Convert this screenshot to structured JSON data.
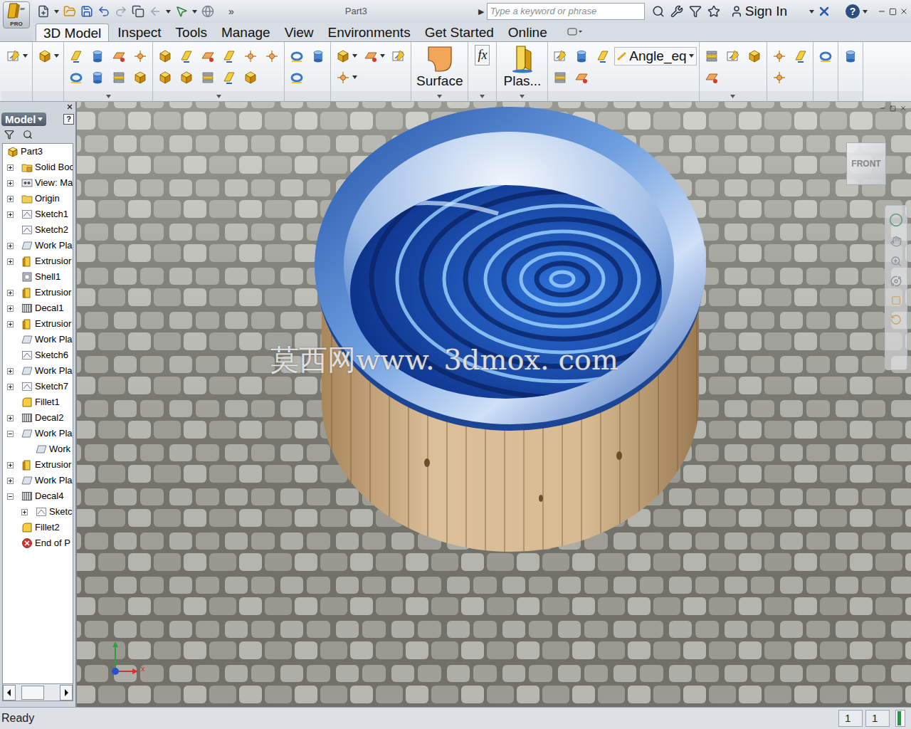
{
  "app": {
    "badge": "PRO"
  },
  "quick_access": {
    "overflow": "»"
  },
  "window": {
    "title": "Part3",
    "title_arrow": "▶"
  },
  "search": {
    "placeholder": "Type a keyword or phrase"
  },
  "account": {
    "sign_in": "Sign In"
  },
  "help": {
    "label": "?"
  },
  "menu_tabs": [
    {
      "label": "3D Model",
      "selected": true
    },
    {
      "label": "Inspect",
      "selected": false
    },
    {
      "label": "Tools",
      "selected": false
    },
    {
      "label": "Manage",
      "selected": false
    },
    {
      "label": "View",
      "selected": false
    },
    {
      "label": "Environments",
      "selected": false
    },
    {
      "label": "Get Started",
      "selected": false
    },
    {
      "label": "Online",
      "selected": false
    }
  ],
  "ribbon": {
    "surface": "Surface",
    "plastic_part": "Plas...",
    "function": "fx",
    "parameter": "Angle_eq"
  },
  "browser": {
    "title": "Model",
    "help": "?",
    "items": [
      {
        "label": "Part3",
        "depth": 0,
        "kind": "part",
        "expandable": false,
        "expanded": false
      },
      {
        "label": "Solid Boc",
        "depth": 1,
        "kind": "solid",
        "expandable": true,
        "expanded": false
      },
      {
        "label": "View: Ma",
        "depth": 1,
        "kind": "view",
        "expandable": true,
        "expanded": false
      },
      {
        "label": "Origin",
        "depth": 1,
        "kind": "folder",
        "expandable": true,
        "expanded": false
      },
      {
        "label": "Sketch1",
        "depth": 1,
        "kind": "sketch",
        "expandable": true,
        "expanded": false
      },
      {
        "label": "Sketch2",
        "depth": 1,
        "kind": "sketch",
        "expandable": false,
        "expanded": false
      },
      {
        "label": "Work Pla",
        "depth": 1,
        "kind": "work-plane",
        "expandable": true,
        "expanded": false
      },
      {
        "label": "Extrusior",
        "depth": 1,
        "kind": "extrusion",
        "expandable": true,
        "expanded": false
      },
      {
        "label": "Shell1",
        "depth": 1,
        "kind": "shell",
        "expandable": false,
        "expanded": false
      },
      {
        "label": "Extrusior",
        "depth": 1,
        "kind": "extrusion",
        "expandable": true,
        "expanded": false
      },
      {
        "label": "Decal1",
        "depth": 1,
        "kind": "decal",
        "expandable": true,
        "expanded": false
      },
      {
        "label": "Extrusior",
        "depth": 1,
        "kind": "extrusion",
        "expandable": true,
        "expanded": false
      },
      {
        "label": "Work Pla",
        "depth": 1,
        "kind": "work-plane",
        "expandable": false,
        "expanded": false
      },
      {
        "label": "Sketch6",
        "depth": 1,
        "kind": "sketch",
        "expandable": false,
        "expanded": false
      },
      {
        "label": "Work Pla",
        "depth": 1,
        "kind": "work-plane",
        "expandable": true,
        "expanded": false
      },
      {
        "label": "Sketch7",
        "depth": 1,
        "kind": "sketch",
        "expandable": true,
        "expanded": false
      },
      {
        "label": "Fillet1",
        "depth": 1,
        "kind": "fillet",
        "expandable": false,
        "expanded": false
      },
      {
        "label": "Decal2",
        "depth": 1,
        "kind": "decal",
        "expandable": true,
        "expanded": false
      },
      {
        "label": "Work Pla",
        "depth": 1,
        "kind": "work-plane",
        "expandable": true,
        "expanded": true
      },
      {
        "label": "Work",
        "depth": 2,
        "kind": "work-plane",
        "expandable": false,
        "expanded": false
      },
      {
        "label": "Extrusior",
        "depth": 1,
        "kind": "extrusion",
        "expandable": true,
        "expanded": false
      },
      {
        "label": "Work Pla",
        "depth": 1,
        "kind": "work-plane",
        "expandable": true,
        "expanded": false
      },
      {
        "label": "Decal4",
        "depth": 1,
        "kind": "decal",
        "expandable": true,
        "expanded": true
      },
      {
        "label": "Sketc",
        "depth": 2,
        "kind": "sketch",
        "expandable": true,
        "expanded": false
      },
      {
        "label": "Fillet2",
        "depth": 1,
        "kind": "fillet",
        "expandable": false,
        "expanded": false
      },
      {
        "label": "End of P",
        "depth": 1,
        "kind": "end",
        "expandable": false,
        "expanded": false
      }
    ]
  },
  "viewport": {
    "view_cube": "FRONT",
    "axis_label": "x",
    "watermark": "莫西网www. 3dmox. com"
  },
  "status_bar": {
    "text": "Ready",
    "fields": [
      "1",
      "1"
    ]
  }
}
